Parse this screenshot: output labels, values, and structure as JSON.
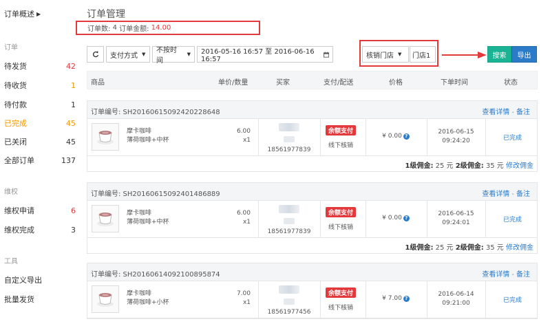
{
  "sidebar": {
    "overview": "订单概述",
    "group_order": "订单",
    "items": [
      {
        "label": "待发货",
        "count": "42"
      },
      {
        "label": "待收货",
        "count": "1"
      },
      {
        "label": "待付款",
        "count": "1"
      },
      {
        "label": "已完成",
        "count": "45"
      },
      {
        "label": "已关闭",
        "count": "45"
      },
      {
        "label": "全部订单",
        "count": "137"
      }
    ],
    "group_rights": "维权",
    "rights_items": [
      {
        "label": "维权申请",
        "count": "6"
      },
      {
        "label": "维权完成",
        "count": "3"
      }
    ],
    "group_tools": "工具",
    "tool_items": [
      {
        "label": "自定义导出"
      },
      {
        "label": "批量发货"
      }
    ]
  },
  "page": {
    "title": "订单管理",
    "summary_count_label": "订单数:",
    "summary_count": "4",
    "summary_amount_label": "订单金额:",
    "summary_amount": "14.00"
  },
  "toolbar": {
    "pay_method": "支付方式",
    "time_filter": "不按时间",
    "date_range": "2016-05-16 16:57 至 2016-06-16 16:57",
    "store_select": "核销门店",
    "store_value": "门店1",
    "search_label": "搜索",
    "export_label": "导出"
  },
  "table_headers": {
    "product": "商品",
    "price_qty": "单价/数量",
    "buyer": "买家",
    "pay_ship": "支付/配送",
    "price": "价格",
    "order_time": "下单时间",
    "status": "状态"
  },
  "orders": [
    {
      "no": "订单编号: SH20160615092420228648",
      "detail_link": "查看详情",
      "note_link": "备注",
      "product_name": "摩卡咖啡",
      "product_spec": "薄荷咖啡+中杯",
      "unit_price": "6.00",
      "qty": "x1",
      "buyer_phone": "18561977839",
      "pay_badge": "余额支付",
      "ship_method": "线下核销",
      "amount": "¥ 0.00",
      "date": "2016-06-15",
      "time": "09:24:20",
      "status": "已完成",
      "comm1_label": "1级佣金:",
      "comm1": "25 元",
      "comm2_label": "2级佣金:",
      "comm2": "35 元",
      "edit_comm": "修改佣金"
    },
    {
      "no": "订单编号: SH20160615092401486889",
      "detail_link": "查看详情",
      "note_link": "备注",
      "product_name": "摩卡咖啡",
      "product_spec": "薄荷咖啡+中杯",
      "unit_price": "6.00",
      "qty": "x1",
      "buyer_phone": "18561977839",
      "pay_badge": "余额支付",
      "ship_method": "线下核销",
      "amount": "¥ 0.00",
      "date": "2016-06-15",
      "time": "09:24:01",
      "status": "已完成",
      "comm1_label": "1级佣金:",
      "comm1": "25 元",
      "comm2_label": "2级佣金:",
      "comm2": "35 元",
      "edit_comm": "修改佣金"
    },
    {
      "no": "订单编号: SH20160614092100895874",
      "detail_link": "查看详情",
      "note_link": "备注",
      "product_name": "摩卡咖啡",
      "product_spec": "薄荷咖啡+小杯",
      "unit_price": "7.00",
      "qty": "x1",
      "buyer_phone": "18561977456",
      "pay_badge": "余额支付",
      "ship_method": "线下核销",
      "amount": "¥ 7.00",
      "date": "2016-06-14",
      "time": "09:21:00",
      "status": "已完成"
    }
  ],
  "colors": {
    "accent_red": "#e4393c",
    "accent_orange": "#f39800",
    "link_blue": "#2b7bc9",
    "search_green": "#1ab394"
  }
}
